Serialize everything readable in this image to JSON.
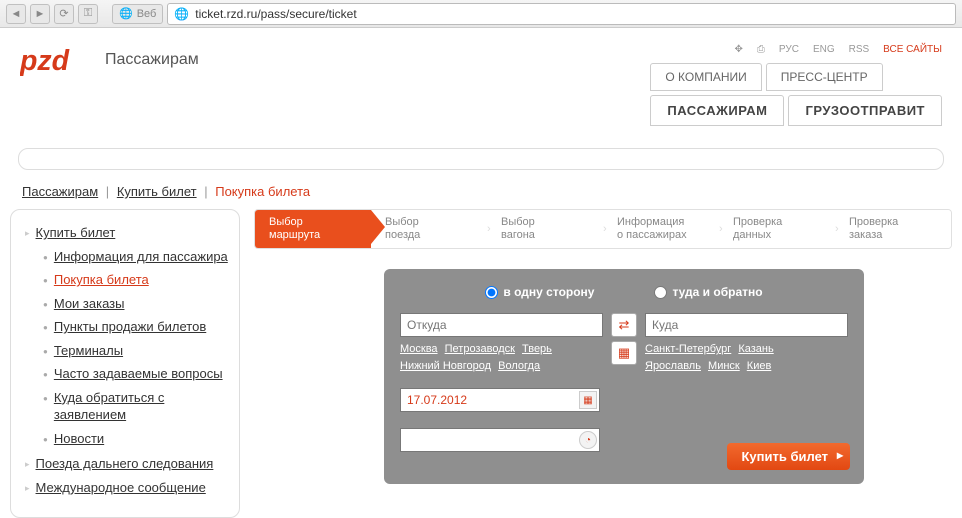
{
  "browser": {
    "web_label": "Веб",
    "url": "ticket.rzd.ru/pass/secure/ticket"
  },
  "header": {
    "logo_text": "Пассажирам",
    "util": {
      "ru": "РУС",
      "en": "ENG",
      "rss": "RSS",
      "all": "ВСЕ САЙТЫ"
    },
    "tabs1": {
      "about": "О КОМПАНИИ",
      "press": "ПРЕСС-ЦЕНТР"
    },
    "tabs2": {
      "passengers": "ПАССАЖИРАМ",
      "cargo": "ГРУЗООТПРАВИТ"
    }
  },
  "breadcrumb": {
    "pass": "Пассажирам",
    "buy": "Купить билет",
    "current": "Покупка билета"
  },
  "sidebar": {
    "buy_ticket": "Купить билет",
    "info": "Информация для пассажира",
    "purchase": "Покупка билета",
    "orders": "Мои заказы",
    "points": "Пункты продажи билетов",
    "terminals": "Терминалы",
    "faq": "Часто задаваемые вопросы",
    "where": "Куда обратиться с заявлением",
    "news": "Новости",
    "longdist": "Поезда дальнего следования",
    "intl": "Международное сообщение"
  },
  "steps": {
    "s1a": "Выбор",
    "s1b": "маршрута",
    "s2a": "Выбор",
    "s2b": "поезда",
    "s3a": "Выбор",
    "s3b": "вагона",
    "s4a": "Информация",
    "s4b": "о пассажирах",
    "s5a": "Проверка",
    "s5b": "данных",
    "s6a": "Проверка",
    "s6b": "заказа"
  },
  "panel": {
    "oneway": "в одну сторону",
    "roundtrip": "туда и обратно",
    "from_placeholder": "Откуда",
    "to_placeholder": "Куда",
    "from_cities": {
      "moscow": "Москва",
      "petrozavodsk": "Петрозаводск",
      "tver": "Тверь",
      "nizhny": "Нижний Новгород",
      "vologda": "Вологда"
    },
    "to_cities": {
      "spb": "Санкт-Петербург",
      "kazan": "Казань",
      "yaroslavl": "Ярославль",
      "minsk": "Минск",
      "kiev": "Киев"
    },
    "date": "17.07.2012",
    "buy_btn": "Купить билет"
  }
}
